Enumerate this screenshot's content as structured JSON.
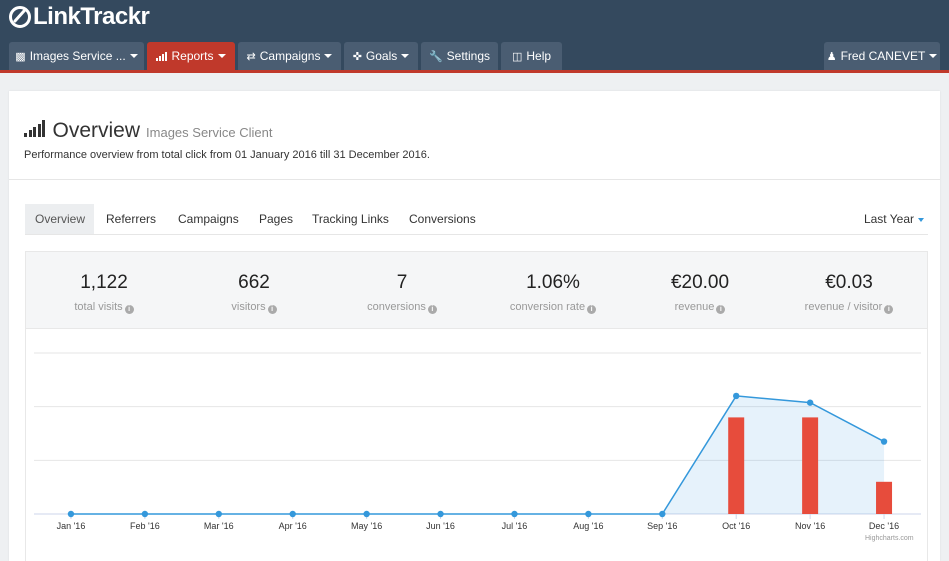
{
  "app": {
    "brand": "LinkTrackr",
    "accent": "#c0392b",
    "nav_bg": "#34495e"
  },
  "nav": {
    "items": [
      {
        "label": "Images Service ...",
        "icon": "cube-icon"
      },
      {
        "label": "Reports",
        "icon": "bar-chart-icon",
        "active": true
      },
      {
        "label": "Campaigns",
        "icon": "shuffle-icon"
      },
      {
        "label": "Goals",
        "icon": "crosshair-icon"
      },
      {
        "label": "Settings",
        "icon": "wrench-icon"
      },
      {
        "label": "Help",
        "icon": "medkit-icon"
      }
    ],
    "user": {
      "label": "Fred CANEVET",
      "icon": "user-icon"
    }
  },
  "page": {
    "title": "Overview",
    "subtitle": "Images Service Client",
    "description": "Performance overview from total click from 01 January 2016 till 31 December 2016."
  },
  "tabs": [
    "Overview",
    "Referrers",
    "Campaigns",
    "Pages",
    "Tracking Links",
    "Conversions"
  ],
  "range": {
    "label": "Last Year"
  },
  "stats": [
    {
      "value": "1,122",
      "label": "total visits"
    },
    {
      "value": "662",
      "label": "visitors"
    },
    {
      "value": "7",
      "label": "conversions"
    },
    {
      "value": "1.06%",
      "label": "conversion rate"
    },
    {
      "value": "€20.00",
      "label": "revenue"
    },
    {
      "value": "€0.03",
      "label": "revenue / visitor"
    }
  ],
  "chart_credit": "Highcharts.com",
  "chart_data": {
    "type": "area",
    "categories": [
      "Jan '16",
      "Feb '16",
      "Mar '16",
      "Apr '16",
      "May '16",
      "Jun '16",
      "Jul '16",
      "Aug '16",
      "Sep '16",
      "Oct '16",
      "Nov '16",
      "Dec '16"
    ],
    "ylim": [
      0,
      600
    ],
    "grid": true,
    "series": [
      {
        "type": "area",
        "color": "#3498db",
        "values": [
          0,
          0,
          0,
          0,
          0,
          0,
          0,
          0,
          0,
          440,
          415,
          270
        ]
      },
      {
        "type": "column",
        "color": "#e74c3c",
        "values": [
          0,
          0,
          0,
          0,
          0,
          0,
          0,
          0,
          0,
          3,
          3,
          1
        ]
      }
    ],
    "column_scale_max": 5
  }
}
